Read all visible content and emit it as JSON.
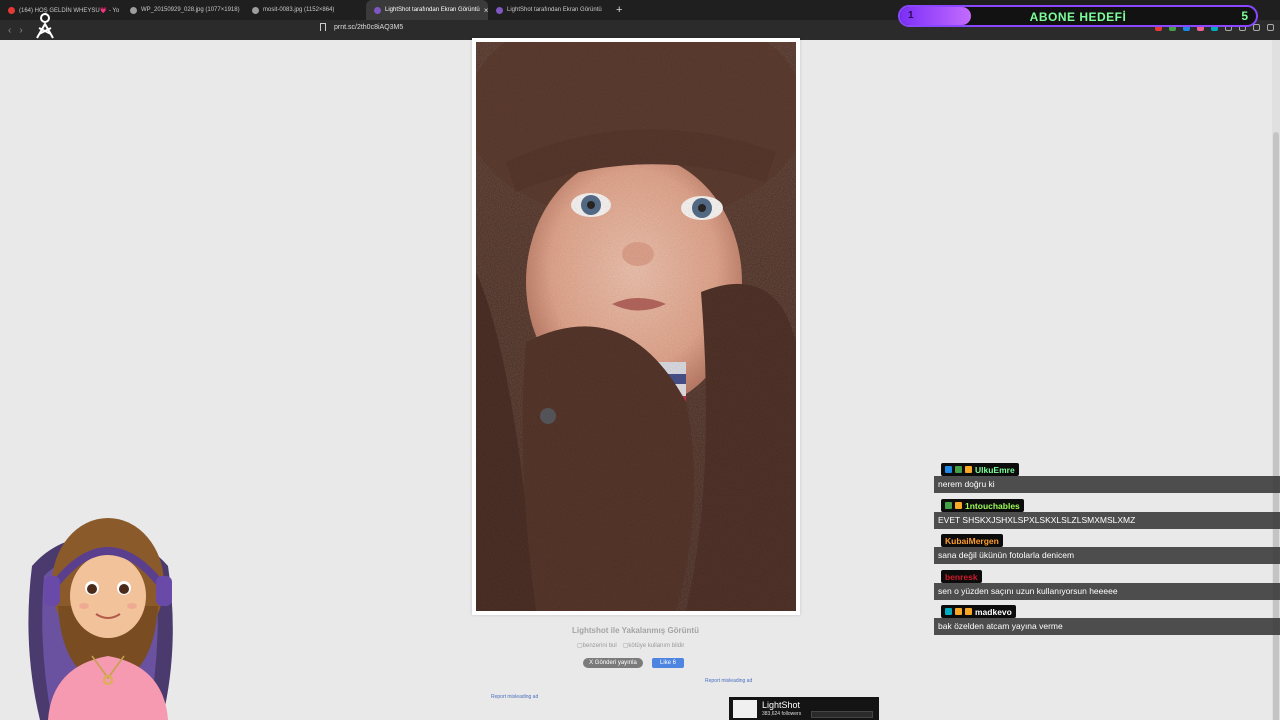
{
  "browser": {
    "tabs": [
      {
        "title": "(164) HOŞ GELDİN WHEYSU💗 - Yo",
        "favicon_color": "#e53935",
        "active": false
      },
      {
        "title": "WP_20150929_028.jpg (1077×1918)",
        "favicon_color": "#9e9e9e",
        "active": false
      },
      {
        "title": "mosit-0083.jpg (1152×864)",
        "favicon_color": "#9e9e9e",
        "active": false
      },
      {
        "title": "LightShot tarafından Ekran Görüntü",
        "favicon_color": "#7e57c2",
        "active": true
      },
      {
        "title": "LightShot tarafından Ekran Görüntü",
        "favicon_color": "#7e57c2",
        "active": false
      }
    ],
    "new_tab": "+",
    "url": "prnt.sc/2th0c8iAQ3M5",
    "back_icon": "back-arrow-icon",
    "forward_icon": "forward-arrow-icon"
  },
  "goal": {
    "label": "ABONE HEDEFİ",
    "current": "1",
    "target": "5",
    "progress": 0.2
  },
  "page": {
    "caption": "Lightshot ile Yakalanmış Görüntü",
    "link1": "benzerini bul",
    "link2": "kötüye kullanım bildir",
    "tweet": "X Gönderi yayınla",
    "like": "Like 6",
    "report1": "Report misleading ad",
    "report2": "Report misleading ad"
  },
  "lightshot_widget": {
    "name": "LightShot",
    "followers": "383,624 followers"
  },
  "chat": [
    {
      "user": "UlkuEmre",
      "color": "#7cff9a",
      "message": "nerem doğru ki",
      "badges": [
        "#1e88e5",
        "#43a047",
        "#f9a825"
      ]
    },
    {
      "user": "1ntouchables",
      "color": "#9eff5a",
      "message": "EVET SHSKXJSHXLSPXLSKXLSLZLSMXMSLXMZ",
      "badges": [
        "#43a047",
        "#f9a825"
      ]
    },
    {
      "user": "KubaiMergen",
      "color": "#ff9d2e",
      "message": "sana değil ükünün fotolarla denicem",
      "badges": []
    },
    {
      "user": "benresk",
      "color": "#d11a2a",
      "message": "sen o yüzden saçını uzun kullanıyorsun heeeee",
      "badges": []
    },
    {
      "user": "madkevo",
      "color": "#ffffff",
      "message": "bak özelden atcam yayına verme",
      "badges": [
        "#00acc1",
        "#f9a825",
        "#f9a825"
      ]
    }
  ]
}
